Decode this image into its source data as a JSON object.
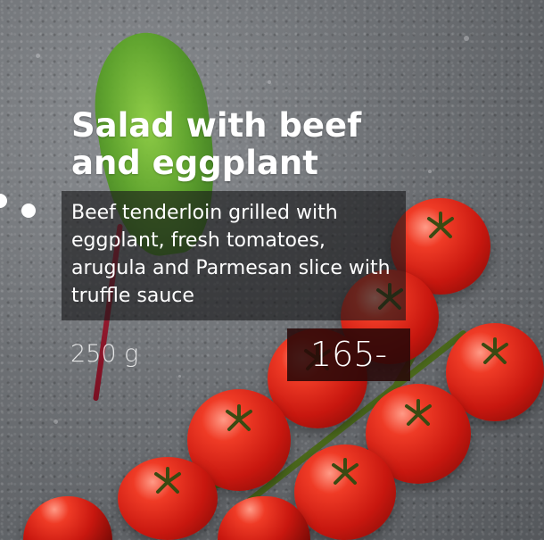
{
  "dish": {
    "title": "Salad with beef and eggplant",
    "description": "Beef tenderloin grilled with eggplant, fresh tomatoes, arugula and Parmesan slice with truffle sauce",
    "weight": "250 g",
    "price": "165-"
  },
  "colors": {
    "title_text": "#ffffff",
    "description_panel": "#161618",
    "price_panel": "#280808"
  },
  "background": {
    "subject": "stone surface with cherry tomatoes on the vine and a chard leaf"
  },
  "pager": {
    "dots": 2
  }
}
